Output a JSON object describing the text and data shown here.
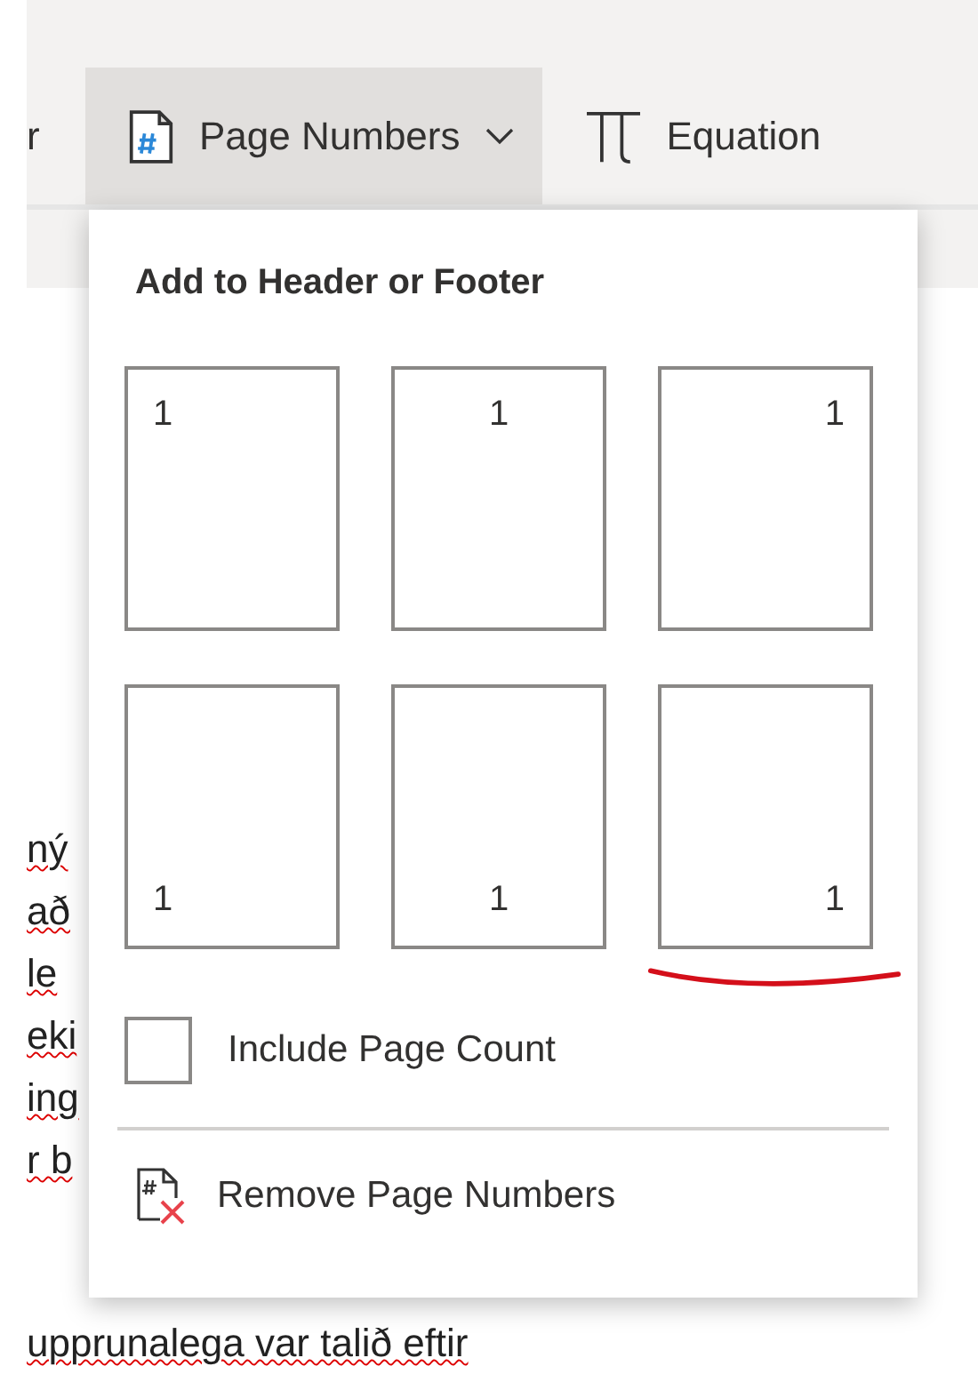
{
  "ribbon": {
    "cut_label": "r",
    "page_numbers": {
      "label": "Page Numbers",
      "expanded": true
    },
    "equation": {
      "label": "Equation"
    }
  },
  "menu": {
    "title": "Add to Header or Footer",
    "tiles": [
      {
        "number": "1",
        "kind": "top-left"
      },
      {
        "number": "1",
        "kind": "top-center"
      },
      {
        "number": "1",
        "kind": "top-right"
      },
      {
        "number": "1",
        "kind": "bottom-left"
      },
      {
        "number": "1",
        "kind": "bottom-center"
      },
      {
        "number": "1",
        "kind": "bottom-right"
      }
    ],
    "include_page_count": {
      "label": "Include Page Count",
      "checked": false
    },
    "remove": {
      "label": "Remove Page Numbers"
    }
  },
  "document": {
    "side_lines": [
      "ný",
      "að",
      "le",
      "eki",
      "ing",
      "r b"
    ],
    "bottom_lines": [
      "upprunalega var talið eftir"
    ]
  }
}
